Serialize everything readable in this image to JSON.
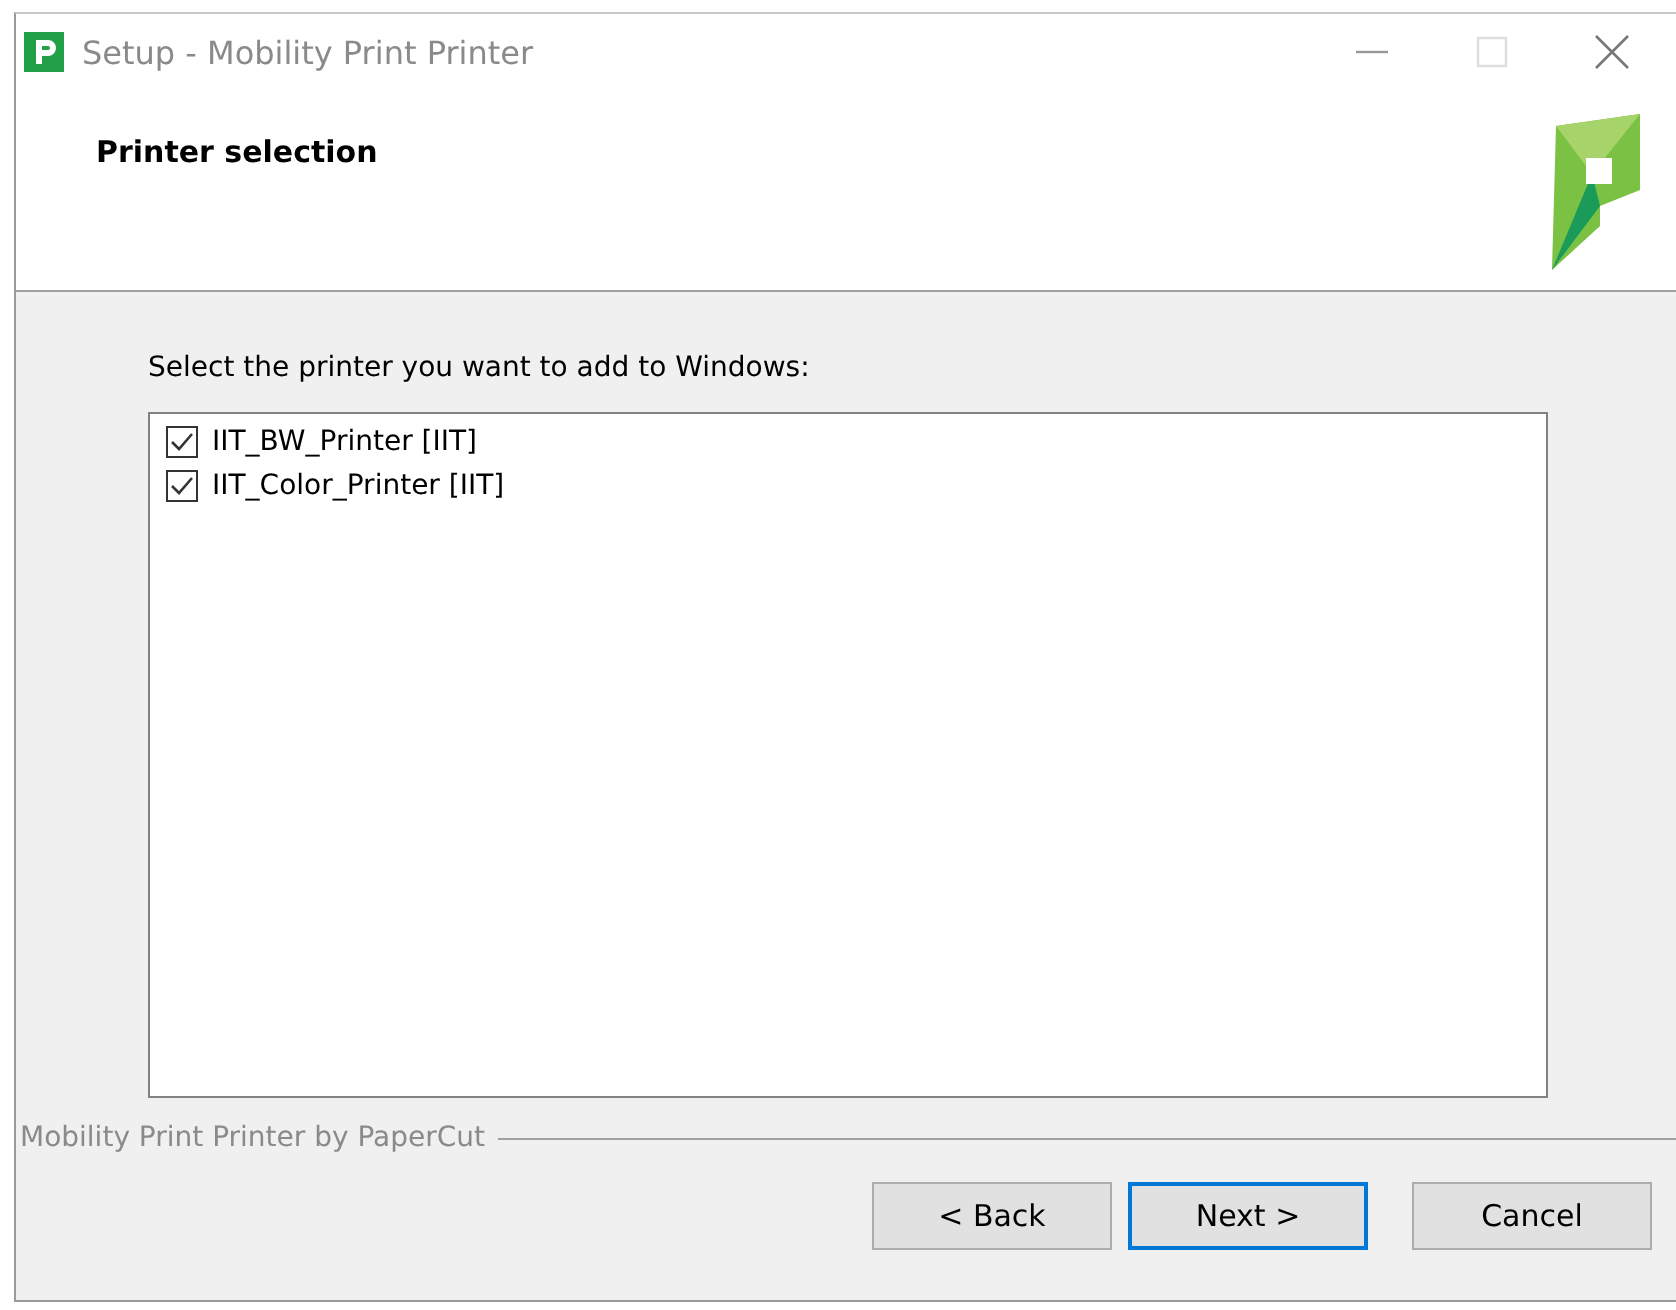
{
  "window": {
    "title": "Setup - Mobility Print Printer"
  },
  "header": {
    "title": "Printer selection"
  },
  "prompt": "Select the printer you want to add to Windows:",
  "printers": [
    {
      "label": "IIT_BW_Printer [IIT]",
      "checked": true
    },
    {
      "label": "IIT_Color_Printer [IIT]",
      "checked": true
    }
  ],
  "footer": {
    "caption": "Mobility Print Printer by PaperCut"
  },
  "buttons": [
    {
      "label": "< Back",
      "default": false
    },
    {
      "label": "Next >",
      "default": true
    },
    {
      "label": "Cancel",
      "default": false
    }
  ]
}
